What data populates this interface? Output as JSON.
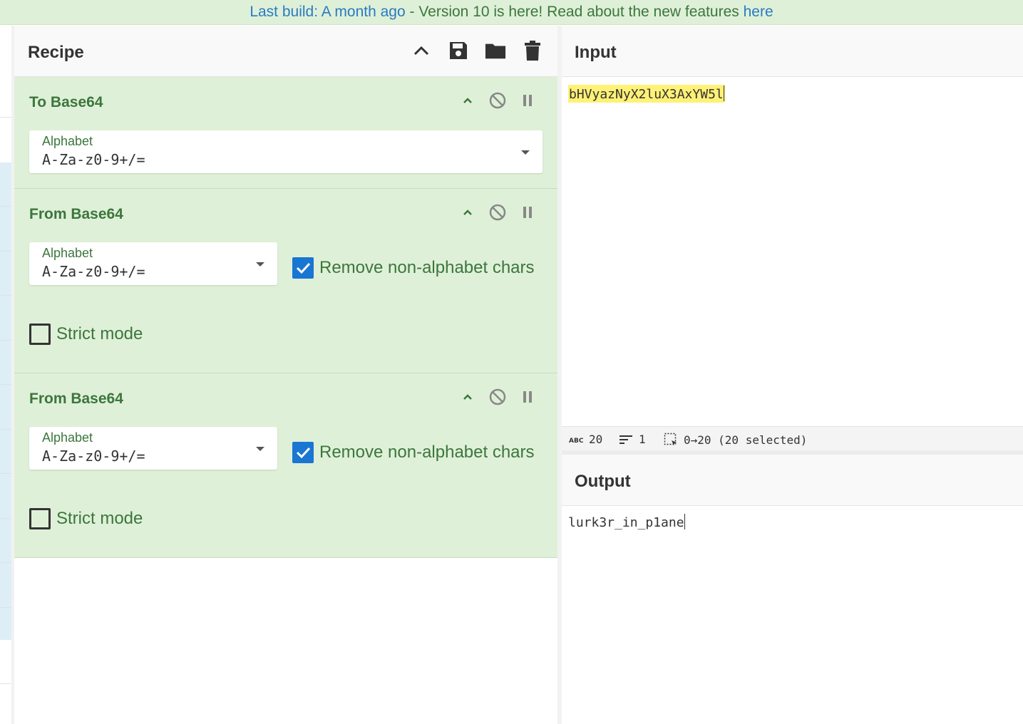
{
  "banner": {
    "link1": "Last build: A month ago",
    "middle": " - Version 10 is here! Read about the new features ",
    "link2": "here"
  },
  "recipe": {
    "title": "Recipe",
    "operations": [
      {
        "name": "To Base64",
        "alphabet_label": "Alphabet",
        "alphabet_value": "A-Za-z0-9+/="
      },
      {
        "name": "From Base64",
        "alphabet_label": "Alphabet",
        "alphabet_value": "A-Za-z0-9+/=",
        "remove_label": "Remove non-alphabet chars",
        "remove_checked": true,
        "strict_label": "Strict mode",
        "strict_checked": false
      },
      {
        "name": "From Base64",
        "alphabet_label": "Alphabet",
        "alphabet_value": "A-Za-z0-9+/=",
        "remove_label": "Remove non-alphabet chars",
        "remove_checked": true,
        "strict_label": "Strict mode",
        "strict_checked": false
      }
    ]
  },
  "input": {
    "title": "Input",
    "text": "bHVyazNyX2luX3AxYW5l"
  },
  "status": {
    "length": "20",
    "lines": "1",
    "selection": "0→20 (20 selected)"
  },
  "output": {
    "title": "Output",
    "text": "lurk3r_in_p1ane"
  },
  "colors": {
    "accent_green": "#3c763d",
    "op_background": "#dff0d8",
    "checkbox_blue": "#1976d2",
    "highlight": "#fff176"
  }
}
